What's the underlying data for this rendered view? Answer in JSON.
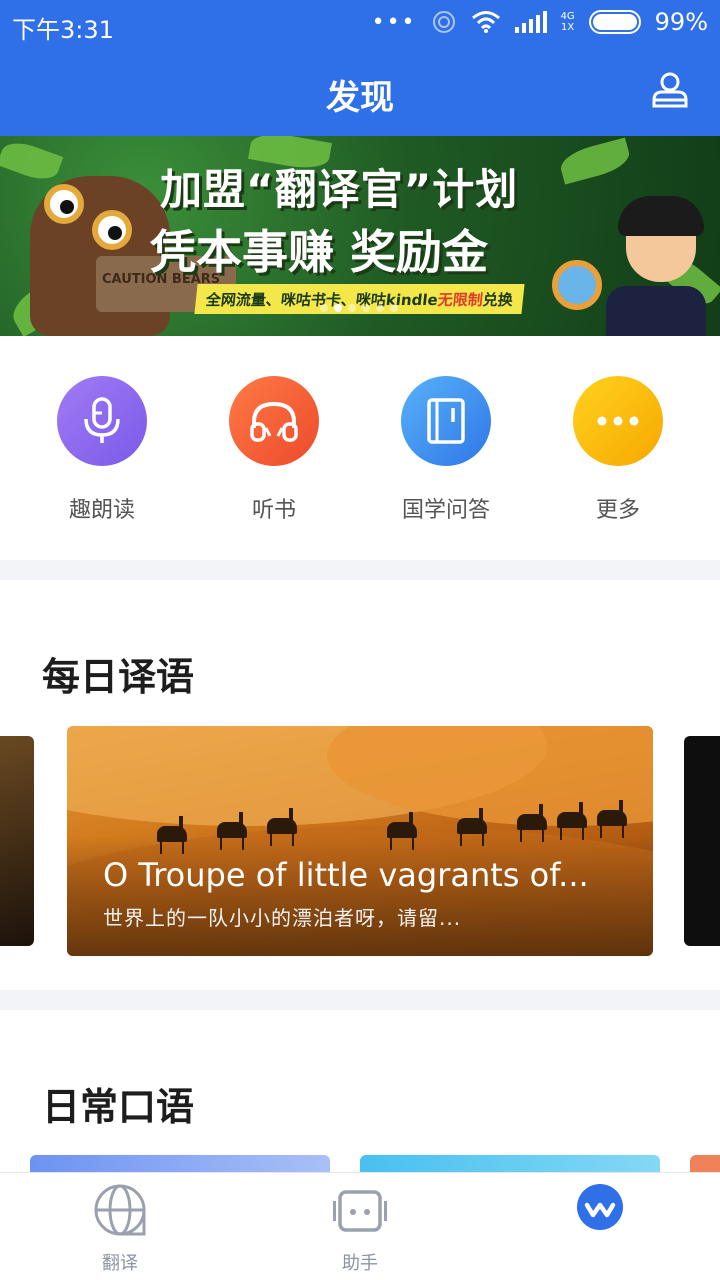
{
  "status_bar": {
    "time": "下午3:31",
    "dots": "•••",
    "network_top": "4G",
    "network_bottom": "1X",
    "battery": "99%"
  },
  "header": {
    "title": "发现",
    "profile_icon": "user-icon"
  },
  "banner": {
    "line1": "加盟“翻译官”计划",
    "line2": "凭本事赚 奖励金",
    "strip_prefix": "全网流量、咪咕书卡、咪咕kindle",
    "strip_highlight": "无限制",
    "strip_suffix": "兑换",
    "sign_text": "CAUTION BEARS",
    "indicator_count": 6,
    "indicator_active": 1
  },
  "features": [
    {
      "label": "趣朗读",
      "icon": "microphone-icon",
      "color": "#8b6cf0"
    },
    {
      "label": "听书",
      "icon": "headphones-icon",
      "color": "#f25a3c"
    },
    {
      "label": "国学问答",
      "icon": "book-icon",
      "color": "#3a8cf0"
    },
    {
      "label": "更多",
      "icon": "more-icon",
      "color": "#f7b400"
    }
  ],
  "daily_quote": {
    "title": "每日译语",
    "card": {
      "english": "O Troupe of little vagrants of...",
      "chinese": "世界上的一队小小的漂泊者呀，请留..."
    }
  },
  "daily_spoken": {
    "title": "日常口语"
  },
  "tabbar": [
    {
      "label": "翻译",
      "icon": "globe-icon"
    },
    {
      "label": "助手",
      "icon": "robot-icon"
    },
    {
      "label": "",
      "icon": "discover-icon",
      "active": true
    }
  ],
  "colors": {
    "primary": "#2f6fe8",
    "tab_inactive": "#8d93a1"
  }
}
